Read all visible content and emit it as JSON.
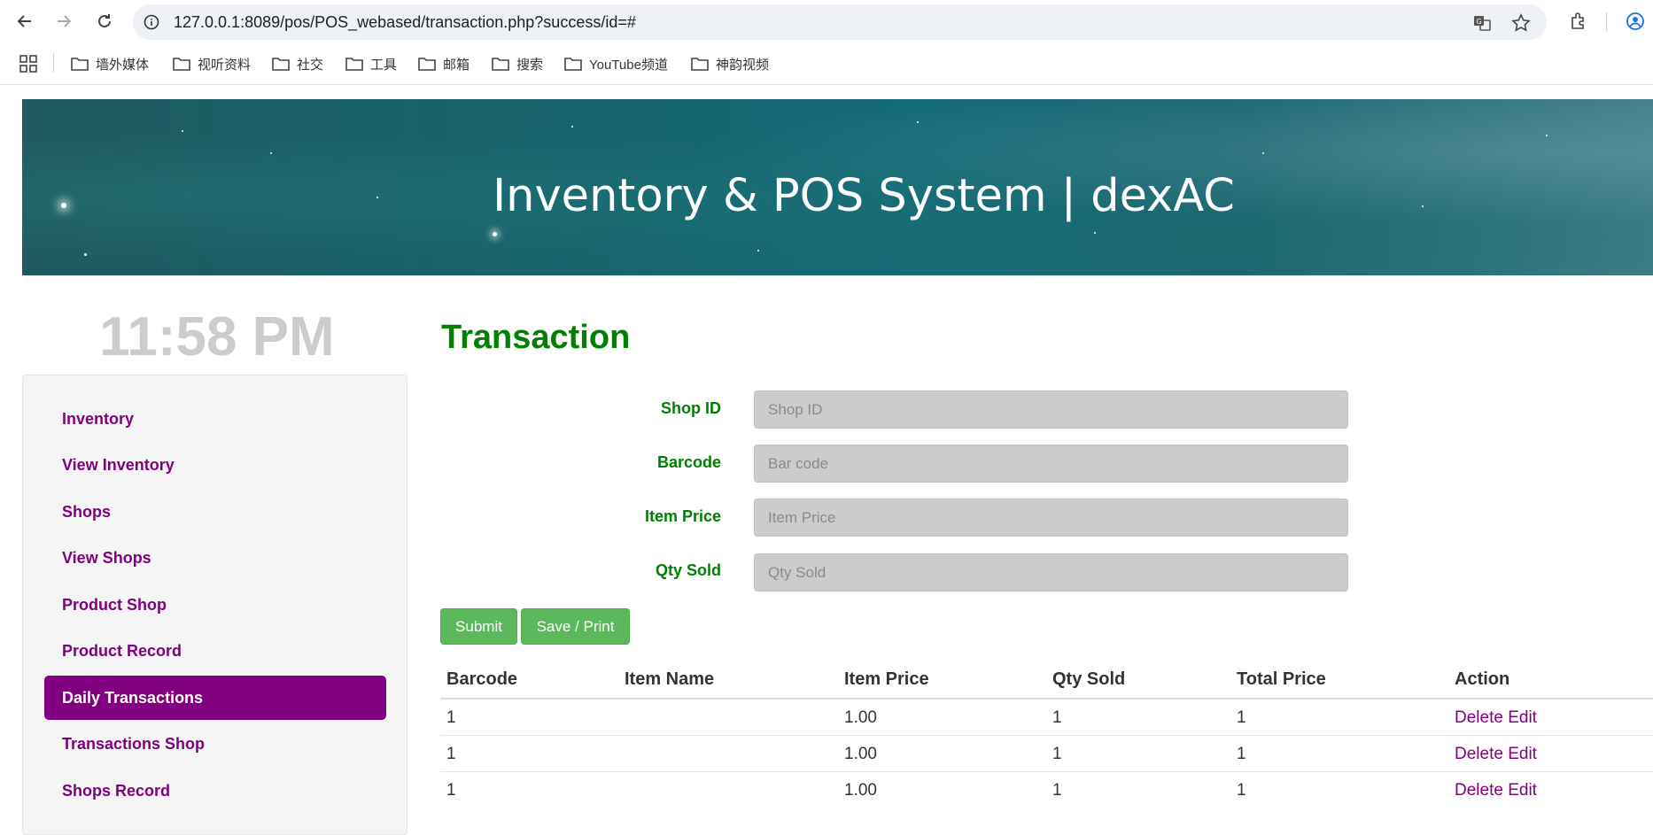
{
  "browser": {
    "url": "127.0.0.1:8089/pos/POS_webased/transaction.php?success/id=#",
    "bookmarks": [
      "墙外媒体",
      "视听资料",
      "社交",
      "工具",
      "邮箱",
      "搜索",
      "YouTube频道",
      "神韵视频"
    ]
  },
  "banner": {
    "title": "Inventory & POS System | dexAC"
  },
  "clock": "11:58 PM",
  "sidebar": {
    "items": [
      {
        "label": "Inventory",
        "active": false
      },
      {
        "label": "View Inventory",
        "active": false
      },
      {
        "label": "Shops",
        "active": false
      },
      {
        "label": "View Shops",
        "active": false
      },
      {
        "label": "Product Shop",
        "active": false
      },
      {
        "label": "Product Record",
        "active": false
      },
      {
        "label": "Daily Transactions",
        "active": true
      },
      {
        "label": "Transactions Shop",
        "active": false
      },
      {
        "label": "Shops Record",
        "active": false
      }
    ]
  },
  "main": {
    "title": "Transaction",
    "form": {
      "shop_id": {
        "label": "Shop ID",
        "placeholder": "Shop ID"
      },
      "barcode": {
        "label": "Barcode",
        "placeholder": "Bar code"
      },
      "item_price": {
        "label": "Item Price",
        "placeholder": "Item Price"
      },
      "qty_sold": {
        "label": "Qty Sold",
        "placeholder": "Qty Sold"
      }
    },
    "buttons": {
      "submit": "Submit",
      "save_print": "Save / Print"
    },
    "table": {
      "headers": [
        "Barcode",
        "Item Name",
        "Item Price",
        "Qty Sold",
        "Total Price",
        "Action"
      ],
      "rows": [
        {
          "barcode": "1",
          "item_name": "",
          "item_price": "1.00",
          "qty_sold": "1",
          "total_price": "1",
          "delete": "Delete",
          "edit": "Edit"
        },
        {
          "barcode": "1",
          "item_name": "",
          "item_price": "1.00",
          "qty_sold": "1",
          "total_price": "1",
          "delete": "Delete",
          "edit": "Edit"
        },
        {
          "barcode": "1",
          "item_name": "",
          "item_price": "1.00",
          "qty_sold": "1",
          "total_price": "1",
          "delete": "Delete",
          "edit": "Edit"
        }
      ]
    }
  },
  "colors": {
    "accent": "#800080",
    "title_green": "#008000",
    "button_green": "#5cb85c",
    "clock_gray": "#cccccc"
  }
}
